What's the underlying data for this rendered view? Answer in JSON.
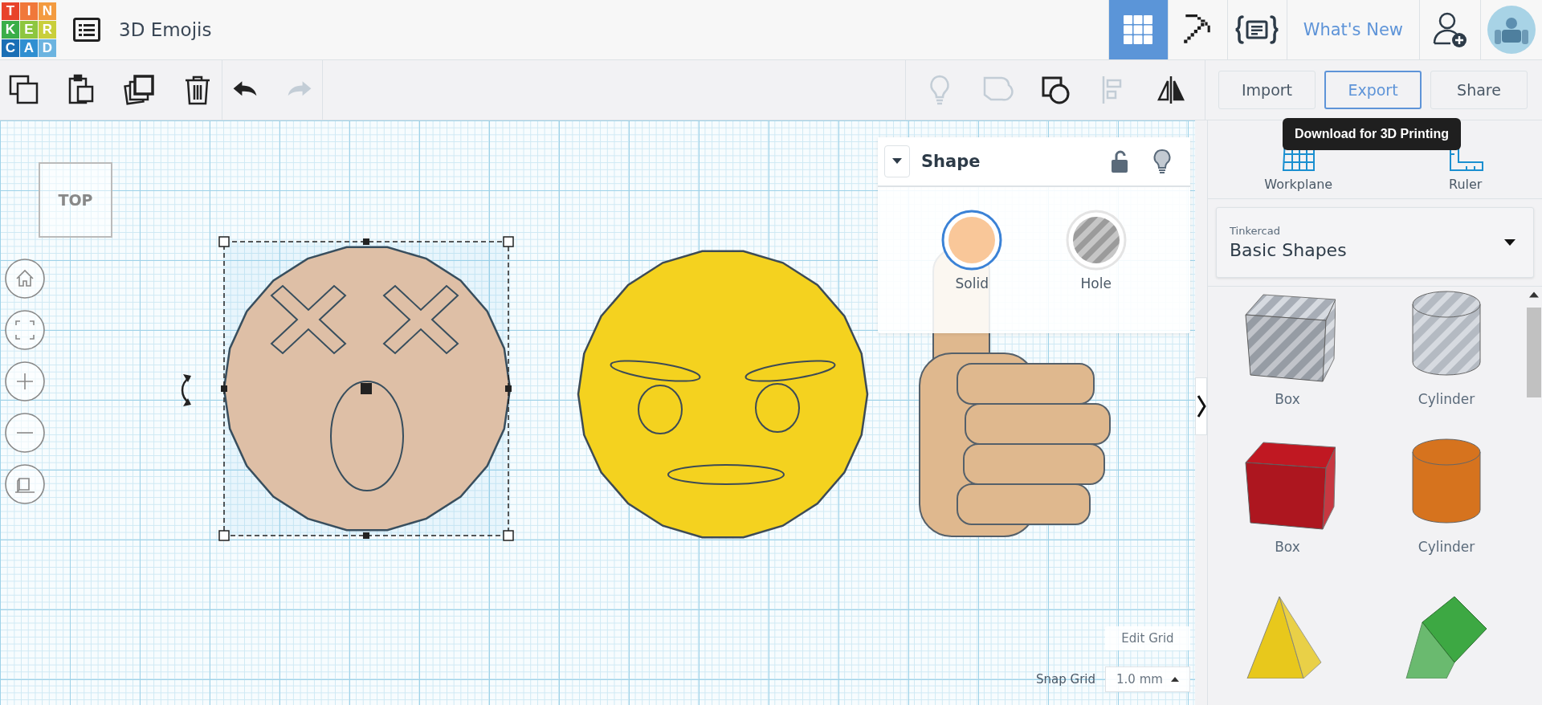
{
  "header": {
    "logo": [
      {
        "letter": "T",
        "color": "#e8432b"
      },
      {
        "letter": "I",
        "color": "#f0783a"
      },
      {
        "letter": "N",
        "color": "#f39b40"
      },
      {
        "letter": "K",
        "color": "#3aae49"
      },
      {
        "letter": "E",
        "color": "#8dc63f"
      },
      {
        "letter": "R",
        "color": "#c9cf3b"
      },
      {
        "letter": "C",
        "color": "#1a6fb5"
      },
      {
        "letter": "A",
        "color": "#2f8fd1"
      },
      {
        "letter": "D",
        "color": "#6cb4e0"
      }
    ],
    "title": "3D Emojis",
    "modes": [
      {
        "kind": "design",
        "selected": true
      },
      {
        "kind": "pickaxe",
        "selected": false
      },
      {
        "kind": "codeblocks",
        "selected": false
      }
    ],
    "whats_new": "What's New"
  },
  "toolbar": {
    "edit_tools": [
      {
        "kind": "copy",
        "disabled": false
      },
      {
        "kind": "paste",
        "disabled": false
      },
      {
        "kind": "duplicate",
        "disabled": false
      },
      {
        "kind": "delete",
        "disabled": false
      }
    ],
    "history_tools": [
      {
        "kind": "undo",
        "disabled": false
      },
      {
        "kind": "redo",
        "disabled": true
      }
    ],
    "shape_tools": [
      {
        "kind": "bulb",
        "disabled": true
      },
      {
        "kind": "group",
        "disabled": true
      },
      {
        "kind": "ungroup",
        "disabled": false
      },
      {
        "kind": "align",
        "disabled": true
      },
      {
        "kind": "mirror",
        "disabled": false
      }
    ],
    "buttons": [
      {
        "label": "Import",
        "selected": false
      },
      {
        "label": "Export",
        "selected": true
      },
      {
        "label": "Share",
        "selected": false
      }
    ],
    "tooltip": "Download for 3D Printing"
  },
  "canvas": {
    "view_cube": "TOP",
    "nav": [
      {
        "kind": "home"
      },
      {
        "kind": "fit"
      },
      {
        "kind": "zoom-in"
      },
      {
        "kind": "zoom-out"
      },
      {
        "kind": "perspective"
      }
    ],
    "objects": [
      {
        "kind": "dizzy-face",
        "selected": true
      },
      {
        "kind": "angry-face",
        "selected": false
      },
      {
        "kind": "thumbs-up",
        "selected": false
      }
    ],
    "shape_panel": {
      "title": "Shape",
      "options": [
        {
          "label": "Solid",
          "kind": "solid",
          "selected": true
        },
        {
          "label": "Hole",
          "kind": "hole",
          "selected": false
        }
      ]
    },
    "edit_grid": "Edit Grid",
    "snap_label": "Snap Grid",
    "snap_value": "1.0 mm"
  },
  "sidebar": {
    "tools": [
      {
        "label": "Workplane",
        "kind": "workplane"
      },
      {
        "label": "Ruler",
        "kind": "ruler"
      }
    ],
    "library": {
      "source": "Tinkercad",
      "name": "Basic Shapes"
    },
    "shapes": [
      {
        "label": "Box",
        "kind": "box",
        "hole": true,
        "color": "#a7adb6"
      },
      {
        "label": "Cylinder",
        "kind": "cylinder",
        "hole": true,
        "color": "#b4bac2"
      },
      {
        "label": "Box",
        "kind": "box",
        "hole": false,
        "color": "#c01822"
      },
      {
        "label": "Cylinder",
        "kind": "cylinder",
        "hole": false,
        "color": "#d6731e"
      },
      {
        "kind": "pyramid",
        "color": "#e8c81c"
      },
      {
        "kind": "roof",
        "color": "#3da843"
      }
    ]
  }
}
